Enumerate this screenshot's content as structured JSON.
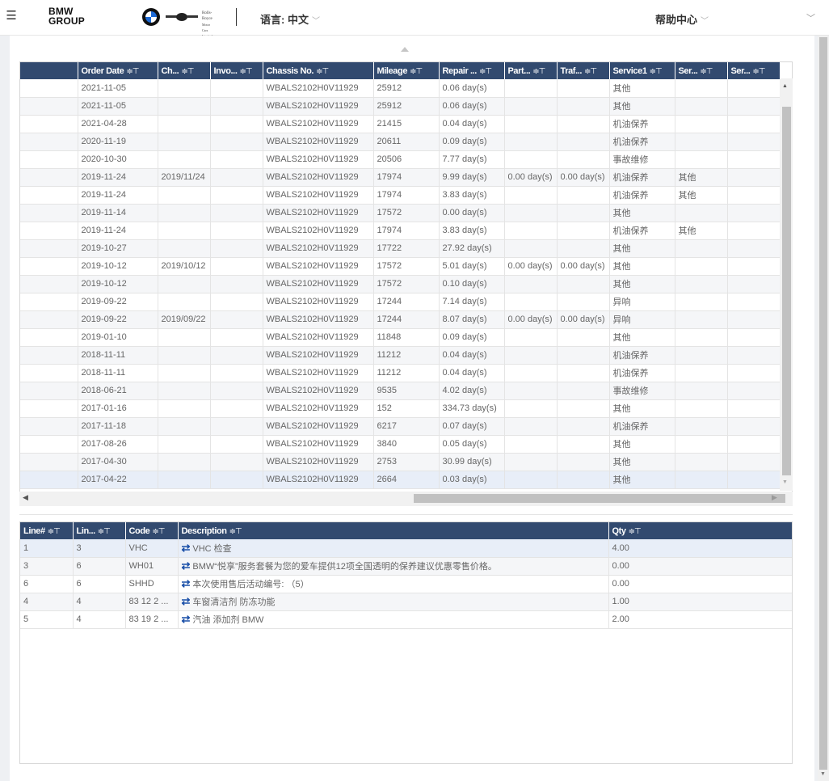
{
  "header": {
    "logo_line1": "BMW",
    "logo_line2": "GROUP",
    "brand_rr_line1": "Rolls-Royce",
    "brand_rr_line2": "Motor Cars Limited",
    "language_label": "语言: 中文",
    "help_label": "帮助中心",
    "chevron": "﹀"
  },
  "colors": {
    "header_bg": "#324a6f",
    "link_icon": "#1a4fa8"
  },
  "orders": {
    "columns": [
      {
        "label": "",
        "width": 71
      },
      {
        "label": "Order Date",
        "width": 99
      },
      {
        "label": "Ch...",
        "width": 65
      },
      {
        "label": "Invo...",
        "width": 65
      },
      {
        "label": "Chassis No.",
        "width": 137
      },
      {
        "label": "Mileage",
        "width": 81
      },
      {
        "label": "Repair ...",
        "width": 81
      },
      {
        "label": "Part...",
        "width": 65
      },
      {
        "label": "Traf...",
        "width": 65
      },
      {
        "label": "Service1",
        "width": 81
      },
      {
        "label": "Ser...",
        "width": 65
      },
      {
        "label": "Ser...",
        "width": 65
      }
    ],
    "sort_filter_icon": "≑⊤",
    "rows": [
      [
        "",
        "2021-11-05",
        "",
        "",
        "WBALS2102H0V11929",
        "25912",
        "0.06 day(s)",
        "",
        "",
        "其他",
        "",
        ""
      ],
      [
        "",
        "2021-11-05",
        "",
        "",
        "WBALS2102H0V11929",
        "25912",
        "0.06 day(s)",
        "",
        "",
        "其他",
        "",
        ""
      ],
      [
        "",
        "2021-04-28",
        "",
        "",
        "WBALS2102H0V11929",
        "21415",
        "0.04 day(s)",
        "",
        "",
        "机油保养",
        "",
        ""
      ],
      [
        "",
        "2020-11-19",
        "",
        "",
        "WBALS2102H0V11929",
        "20611",
        "0.09 day(s)",
        "",
        "",
        "机油保养",
        "",
        ""
      ],
      [
        "",
        "2020-10-30",
        "",
        "",
        "WBALS2102H0V11929",
        "20506",
        "7.77 day(s)",
        "",
        "",
        "事故维修",
        "",
        ""
      ],
      [
        "",
        "2019-11-24",
        "2019/11/24",
        "",
        "WBALS2102H0V11929",
        "17974",
        "9.99 day(s)",
        "0.00 day(s)",
        "0.00 day(s)",
        "机油保养",
        "其他",
        ""
      ],
      [
        "",
        "2019-11-24",
        "",
        "",
        "WBALS2102H0V11929",
        "17974",
        "3.83 day(s)",
        "",
        "",
        "机油保养",
        "其他",
        ""
      ],
      [
        "",
        "2019-11-14",
        "",
        "",
        "WBALS2102H0V11929",
        "17572",
        "0.00 day(s)",
        "",
        "",
        "其他",
        "",
        ""
      ],
      [
        "",
        "2019-11-24",
        "",
        "",
        "WBALS2102H0V11929",
        "17974",
        "3.83 day(s)",
        "",
        "",
        "机油保养",
        "其他",
        ""
      ],
      [
        "",
        "2019-10-27",
        "",
        "",
        "WBALS2102H0V11929",
        "17722",
        "27.92 day(s)",
        "",
        "",
        "其他",
        "",
        ""
      ],
      [
        "",
        "2019-10-12",
        "2019/10/12",
        "",
        "WBALS2102H0V11929",
        "17572",
        "5.01 day(s)",
        "0.00 day(s)",
        "0.00 day(s)",
        "其他",
        "",
        ""
      ],
      [
        "",
        "2019-10-12",
        "",
        "",
        "WBALS2102H0V11929",
        "17572",
        "0.10 day(s)",
        "",
        "",
        "其他",
        "",
        ""
      ],
      [
        "",
        "2019-09-22",
        "",
        "",
        "WBALS2102H0V11929",
        "17244",
        "7.14 day(s)",
        "",
        "",
        "异响",
        "",
        ""
      ],
      [
        "",
        "2019-09-22",
        "2019/09/22",
        "",
        "WBALS2102H0V11929",
        "17244",
        "8.07 day(s)",
        "0.00 day(s)",
        "0.00 day(s)",
        "异响",
        "",
        ""
      ],
      [
        "",
        "2019-01-10",
        "",
        "",
        "WBALS2102H0V11929",
        "11848",
        "0.09 day(s)",
        "",
        "",
        "其他",
        "",
        ""
      ],
      [
        "",
        "2018-11-11",
        "",
        "",
        "WBALS2102H0V11929",
        "11212",
        "0.04 day(s)",
        "",
        "",
        "机油保养",
        "",
        ""
      ],
      [
        "",
        "2018-11-11",
        "",
        "",
        "WBALS2102H0V11929",
        "11212",
        "0.04 day(s)",
        "",
        "",
        "机油保养",
        "",
        ""
      ],
      [
        "",
        "2018-06-21",
        "",
        "",
        "WBALS2102H0V11929",
        "9535",
        "4.02 day(s)",
        "",
        "",
        "事故维修",
        "",
        ""
      ],
      [
        "",
        "2017-01-16",
        "",
        "",
        "WBALS2102H0V11929",
        "152",
        "334.73 day(s)",
        "",
        "",
        "其他",
        "",
        ""
      ],
      [
        "",
        "2017-11-18",
        "",
        "",
        "WBALS2102H0V11929",
        "6217",
        "0.07 day(s)",
        "",
        "",
        "机油保养",
        "",
        ""
      ],
      [
        "",
        "2017-08-26",
        "",
        "",
        "WBALS2102H0V11929",
        "3840",
        "0.05 day(s)",
        "",
        "",
        "其他",
        "",
        ""
      ],
      [
        "",
        "2017-04-30",
        "",
        "",
        "WBALS2102H0V11929",
        "2753",
        "30.99 day(s)",
        "",
        "",
        "其他",
        "",
        ""
      ],
      [
        "",
        "2017-04-22",
        "",
        "",
        "WBALS2102H0V11929",
        "2664",
        "0.03 day(s)",
        "",
        "",
        "其他",
        "",
        ""
      ]
    ],
    "selected_row": 22
  },
  "lines": {
    "columns": [
      {
        "label": "Line#",
        "width": 65
      },
      {
        "label": "Lin...",
        "width": 65
      },
      {
        "label": "Code",
        "width": 65
      },
      {
        "label": "Description",
        "width": 533
      },
      {
        "label": "Qty",
        "width": 229
      }
    ],
    "link_icon": "⇄",
    "rows": [
      [
        "1",
        "3",
        "VHC",
        "VHC 检查",
        "4.00"
      ],
      [
        "3",
        "6",
        "WH01",
        "BMW“悦享”服务套餐为您的爱车提供12项全国透明的保养建议优惠零售价格。",
        "0.00"
      ],
      [
        "6",
        "6",
        "SHHD",
        "本次使用售后活动编号: （5）",
        "0.00"
      ],
      [
        "4",
        "4",
        "83 12 2 ...",
        "车窗清洁剂 防冻功能",
        "1.00"
      ],
      [
        "5",
        "4",
        "83 19 2 ...",
        "汽油 添加剂 BMW",
        "2.00"
      ]
    ],
    "selected_row": 0
  }
}
